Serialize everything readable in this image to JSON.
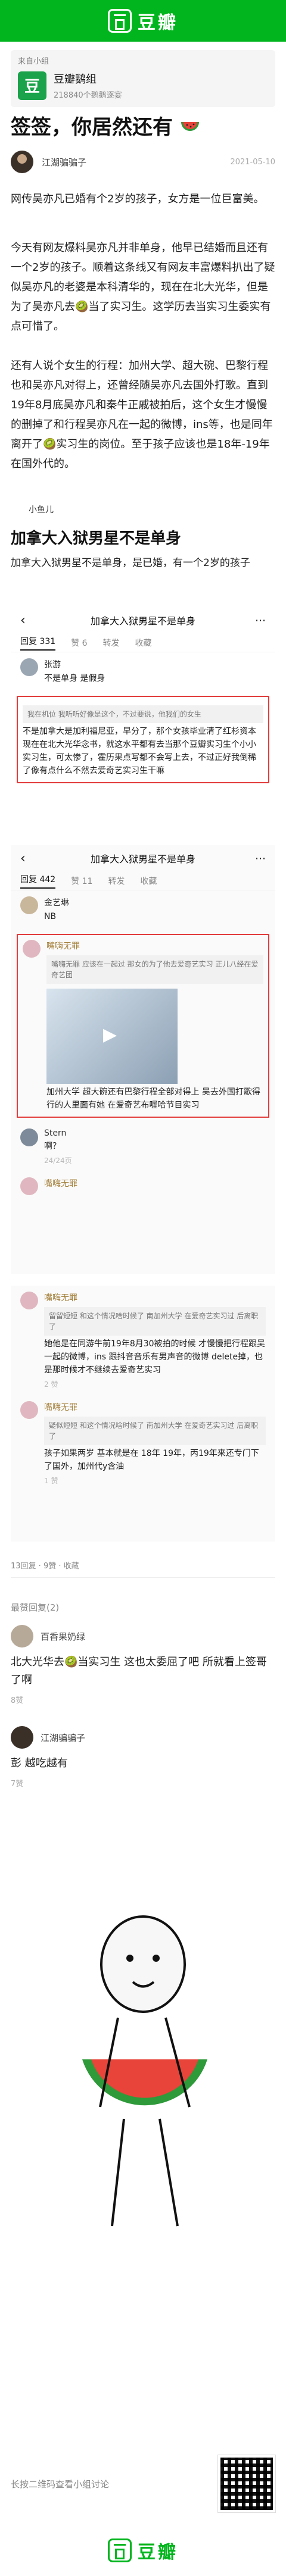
{
  "header": {
    "brand": "豆瓣"
  },
  "group": {
    "source_label": "来自小组",
    "name": "豆瓣鹅组",
    "members": "218840个鹅鹅逐宴",
    "avatar_char": "豆"
  },
  "post": {
    "title": "签签，你居然还有",
    "author": "江湖骗骗子",
    "time": "2021-05-10",
    "paragraphs": [
      "网传吴亦凡已婚有个2岁的孩子，女方是一位巨富美。",
      "今天有网友爆料吴亦凡并非单身，他早已结婚而且还有一个2岁的孩子。顺着这条线又有网友丰富爆料扒出了疑似吴亦凡的老婆是本科清华的，现在在北大光华，但是为了吴亦凡去🥝当了实习生。这学历去当实习生委实有点可惜了。",
      "还有人说个女生的行程：加州大学、超大碗、巴黎行程也和吴亦凡对得上，还曾经随吴亦凡去国外打歌。直到19年8月底吴亦凡和秦牛正戚被拍后，这个女生才慢慢的删掉了和行程吴亦凡在一起的微博，ins等，也是同年离开了🥝实习生的岗位。至于孩子应该也是18年-19年在国外代的。"
    ]
  },
  "shot1": {
    "user": "小鱼儿",
    "headline": "加拿大入狱男星不是单身",
    "text": "加拿大入狱男星不是单身，是已婚，有一个2岁的孩子"
  },
  "shot2": {
    "nav_title": "加拿大入狱男星不是单身",
    "tabs": [
      "回复 331",
      "赞 6",
      "转发",
      "收藏"
    ],
    "c1_name": "张游",
    "c1_text": "不是单身 是假身",
    "c2_quote": "我在机位 我听听好像是这个，不过要说，他我们的女生",
    "c2_text": "不是加拿大是加利福尼亚，早分了，那个女孩毕业清了红杉资本现在在北大光华念书，就这水平都有去当那个豆瓣实习生个小小实习生，可太惨了，霍历果点写都不会写上去，不过正好我倒稀了像有点什么不然去爱奇艺实习生干嘛"
  },
  "shot3": {
    "nav_title": "加拿大入狱男星不是单身",
    "tabs": [
      "回复 442",
      "赞 11",
      "转发",
      "收藏"
    ],
    "c1_name": "金艺琳",
    "c1_text": "NB",
    "c2_name": "嘴嗨无罪",
    "c2_quote": "嘴嗨无罪 应该在一起过 那女的为了他去爱奇艺实习 正儿八经在爱奇艺团",
    "c2_text": "加州大学 超大碗还有巴黎行程全部对得上 吴去外国打歌得行的人里面有她 在爱奇艺布喔哈节目实习",
    "c3_name": "Stern",
    "c3_text": "啊？",
    "c3_counter": "24/24页",
    "c3_hint": "嘴嗨无罪"
  },
  "shot4": {
    "c1_name": "嘴嗨无罪",
    "c1_quote": "留留短短 和这个情况啥时候了 南加州大学 在爱奇艺实习过 后离职了",
    "c1_text": "她他是在同游牛前19年8月30被拍的时候 才慢慢把行程跟吴一起的微博，ins 跟抖音音乐有男声音的微博 delete掉，也是那时候才不继续去爱奇艺实习",
    "c1_like": "2 赞",
    "c2_name": "嘴嗨无罪",
    "c2_quote": "疑似短短 和这个情况啥时候了 南加州大学 在爱奇艺实习过 后离职了",
    "c2_text": "孩子如果两岁 基本就是在 18年 19年，丙19年来还专门下了国外，加州代y含油",
    "c2_like": "1 赞"
  },
  "footer_stats": {
    "likes": "13回复 · 9赞 · 收藏"
  },
  "comments": {
    "section_label": "最赞回复(2)",
    "items": [
      {
        "name": "百香果奶绿",
        "text": "北大光华去🥝当实习生 这也太委屈了吧 所就看上签哥了啊",
        "like": "8赞"
      },
      {
        "name": "江湖骗骗子",
        "text": "彭 越吃越有",
        "like": "7赞"
      }
    ]
  },
  "footer": {
    "qr_text": "长按二维码查看小组讨论",
    "brand": "豆瓣"
  }
}
